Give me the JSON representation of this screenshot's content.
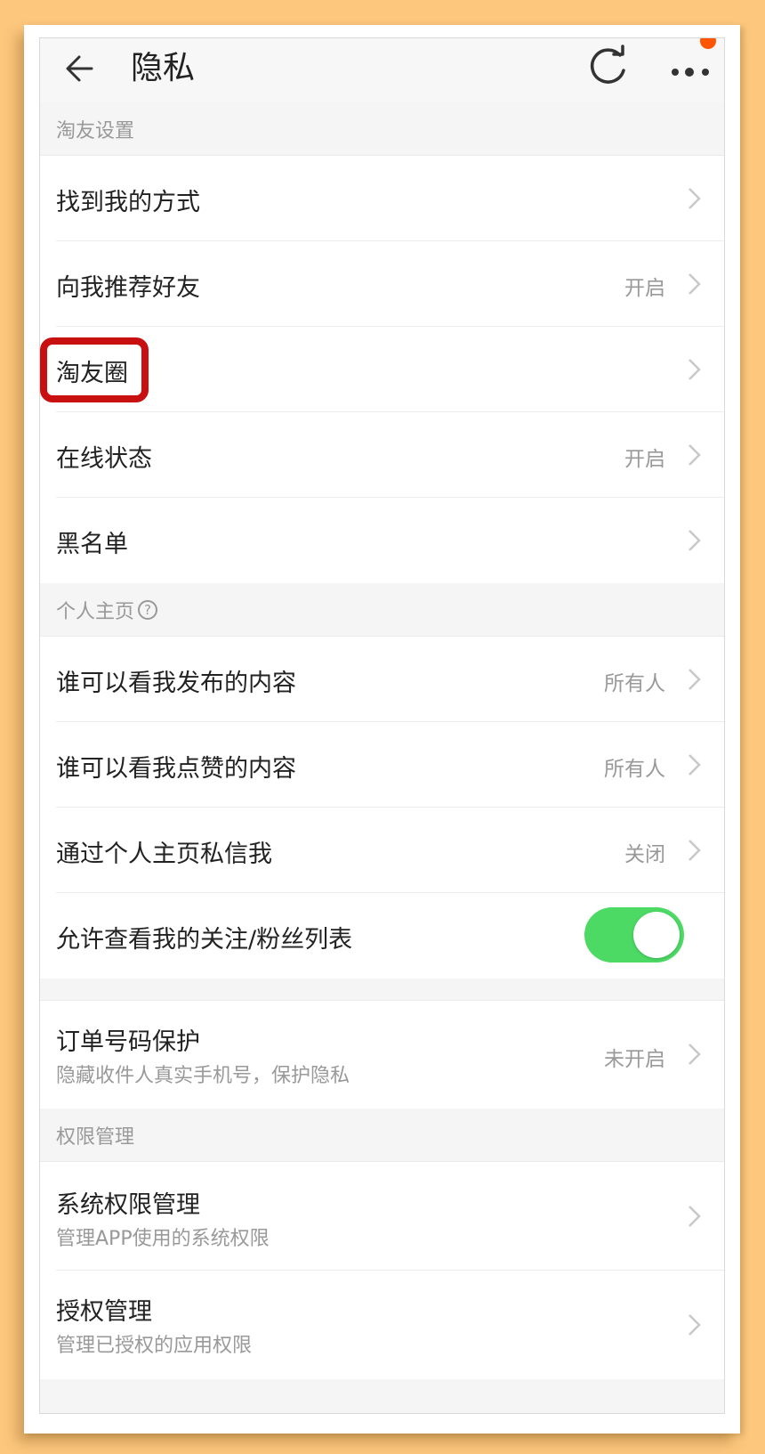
{
  "header": {
    "title": "隐私",
    "back_icon": "arrow-left-icon",
    "refresh_icon": "refresh-icon",
    "more_icon": "more-dots-icon",
    "notification_dot_color": "#ff5500"
  },
  "sections": {
    "friends": {
      "title": "淘友设置",
      "items": [
        {
          "label": "找到我的方式",
          "value": ""
        },
        {
          "label": "向我推荐好友",
          "value": "开启"
        },
        {
          "label": "淘友圈",
          "value": ""
        },
        {
          "label": "在线状态",
          "value": "开启"
        },
        {
          "label": "黑名单",
          "value": ""
        }
      ]
    },
    "homepage": {
      "title": "个人主页",
      "help_icon": "question-circle-icon",
      "items": [
        {
          "label": "谁可以看我发布的内容",
          "value": "所有人"
        },
        {
          "label": "谁可以看我点赞的内容",
          "value": "所有人"
        },
        {
          "label": "通过个人主页私信我",
          "value": "关闭"
        },
        {
          "label": "允许查看我的关注/粉丝列表",
          "toggle_on": true
        }
      ]
    },
    "order": {
      "items": [
        {
          "label": "订单号码保护",
          "sublabel": "隐藏收件人真实手机号，保护隐私",
          "value": "未开启"
        }
      ]
    },
    "permissions": {
      "title": "权限管理",
      "items": [
        {
          "label": "系统权限管理",
          "sublabel": "管理APP使用的系统权限"
        },
        {
          "label": "授权管理",
          "sublabel": "管理已授权的应用权限"
        }
      ]
    }
  },
  "colors": {
    "page_background": "#fdc77e",
    "toggle_on": "#4cd964",
    "highlight": "#c81010"
  }
}
